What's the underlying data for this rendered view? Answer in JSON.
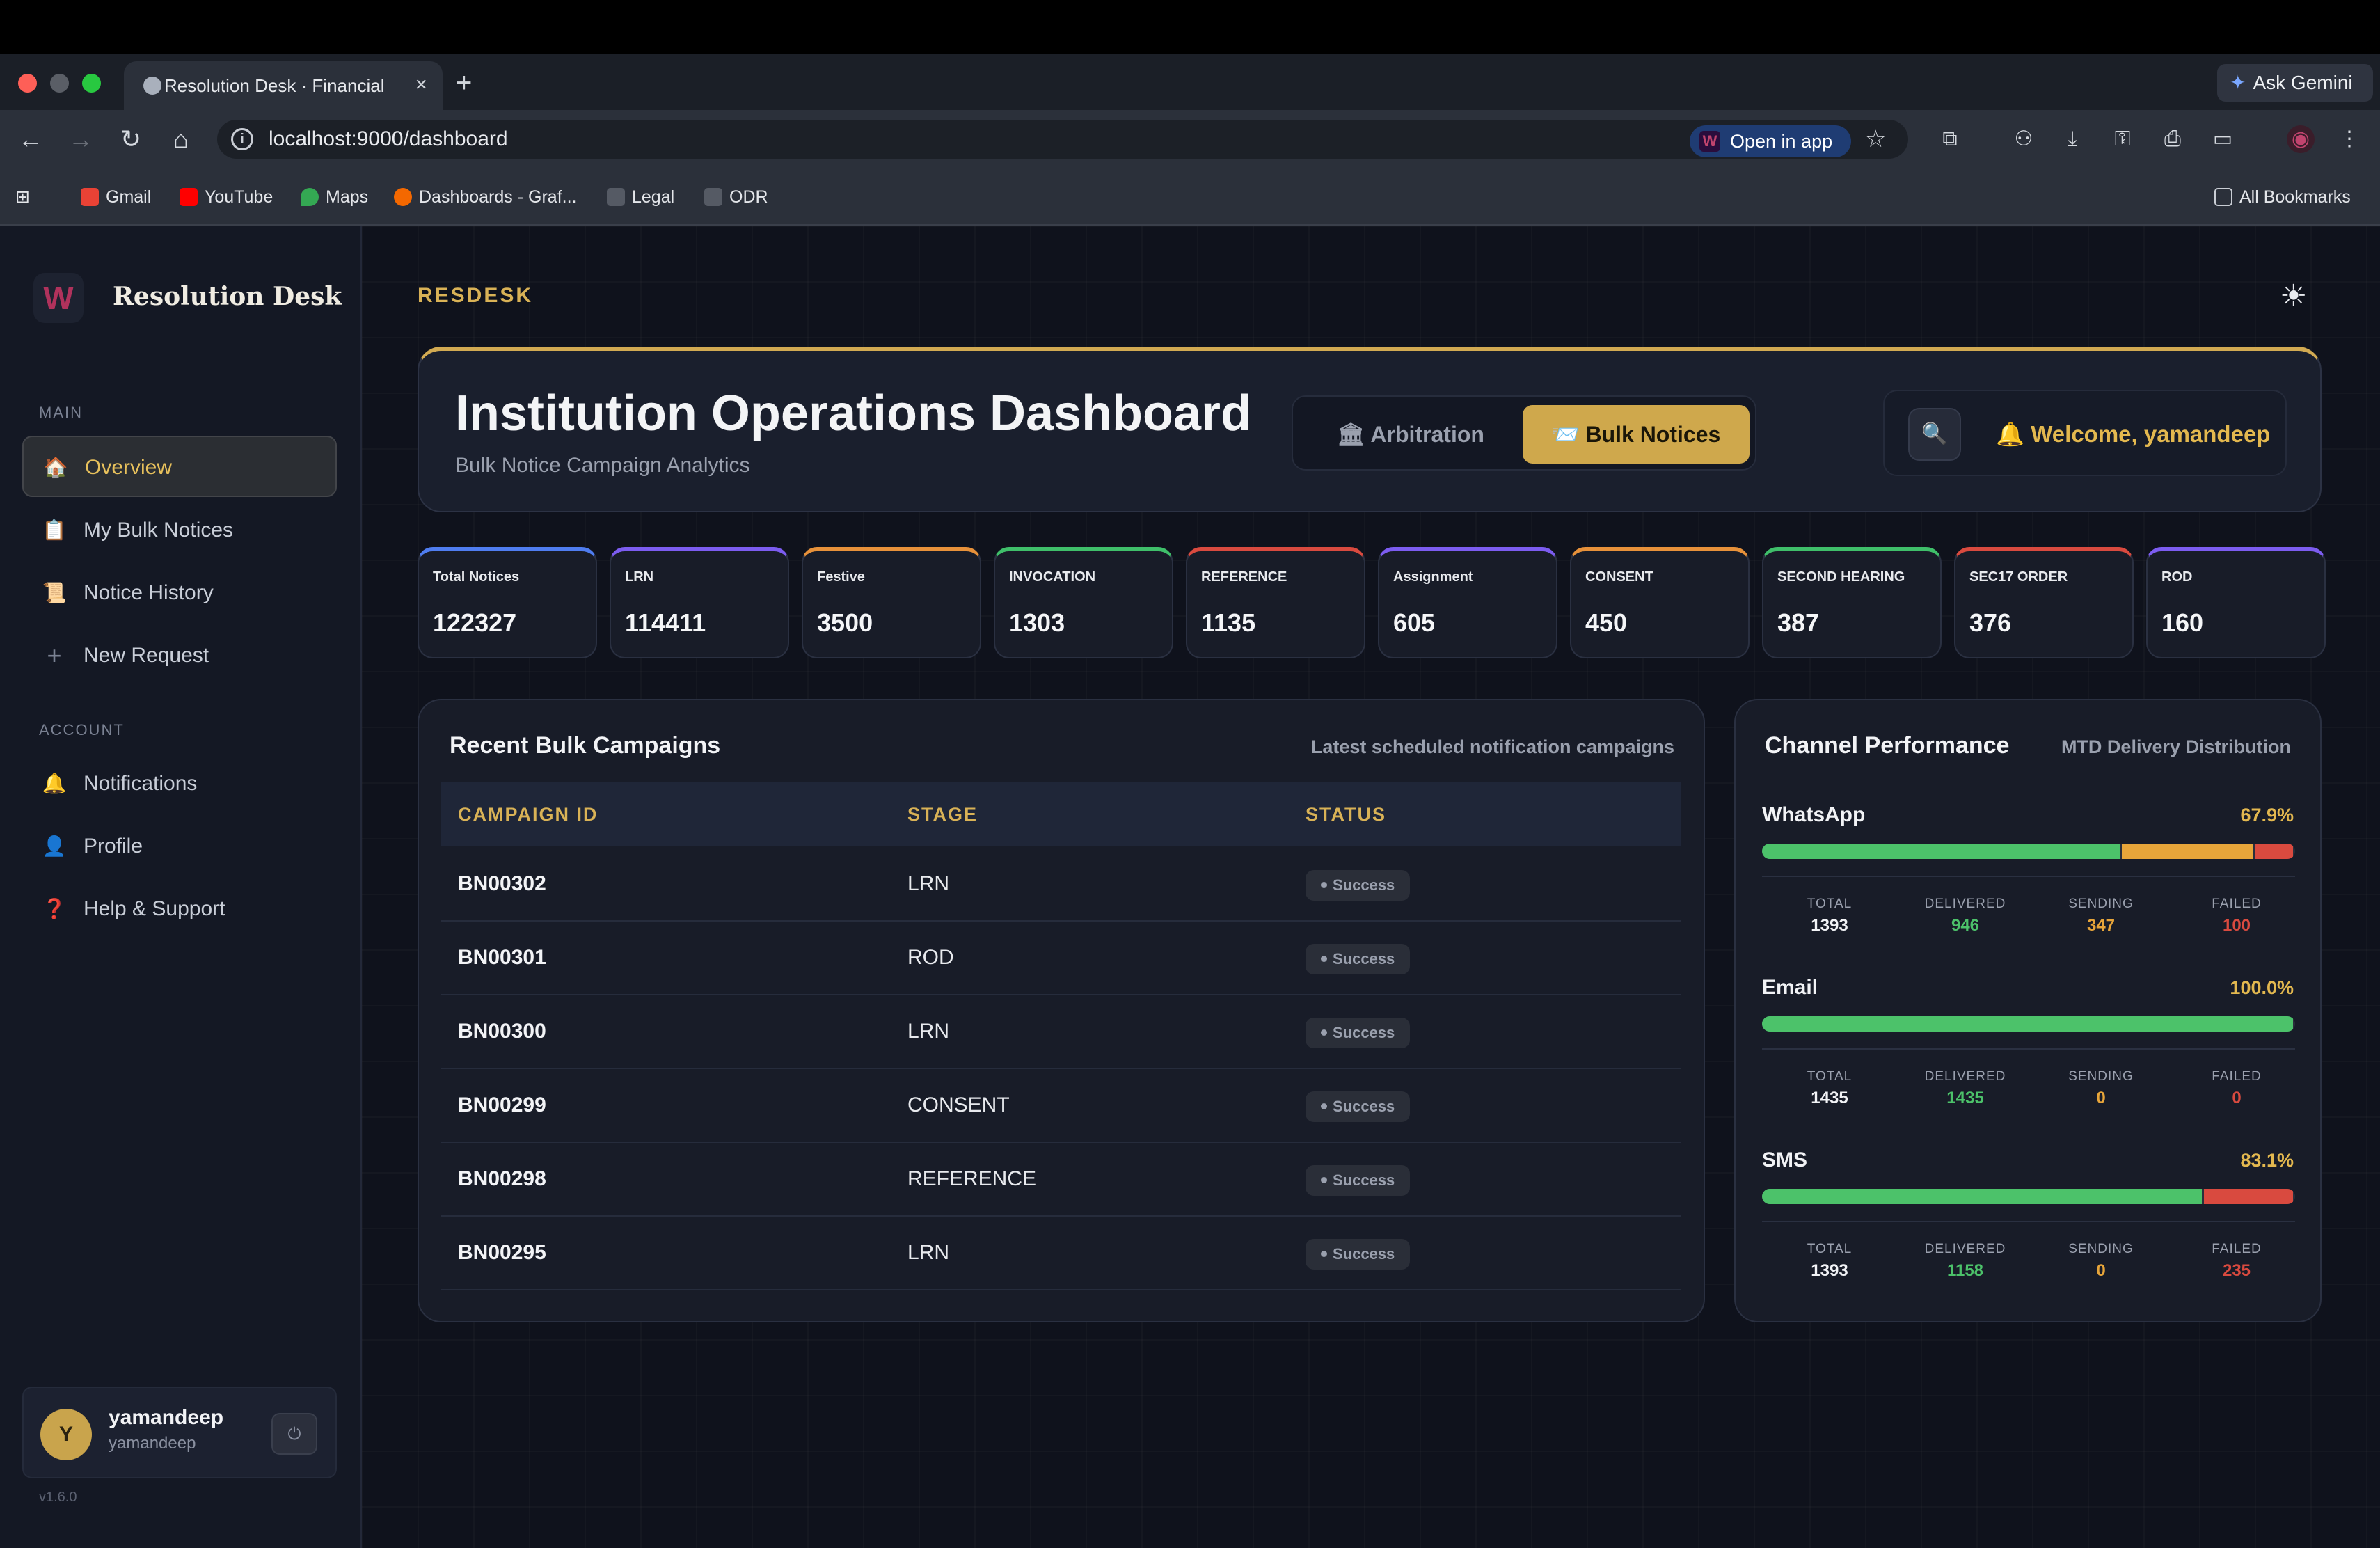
{
  "browser": {
    "tab_title": "Resolution Desk · Financial In",
    "url": "localhost:9000/dashboard",
    "open_in_app": "Open in app",
    "ask_gemini": "Ask Gemini",
    "bookmarks": [
      "Gmail",
      "YouTube",
      "Maps",
      "Dashboards - Graf...",
      "Legal",
      "ODR"
    ],
    "all_bookmarks": "All Bookmarks"
  },
  "sidebar": {
    "brand": "Resolution Desk",
    "logo_letter": "W",
    "main_label": "MAIN",
    "main_items": [
      {
        "label": "Overview",
        "icon": "🏠"
      },
      {
        "label": "My Bulk Notices",
        "icon": "📋"
      },
      {
        "label": "Notice History",
        "icon": "📜"
      },
      {
        "label": "New Request",
        "icon": "+"
      }
    ],
    "account_label": "ACCOUNT",
    "account_items": [
      {
        "label": "Notifications",
        "icon": "🔔"
      },
      {
        "label": "Profile",
        "icon": "👤"
      },
      {
        "label": "Help & Support",
        "icon": "❓"
      }
    ],
    "user": {
      "initial": "Y",
      "name": "yamandeep",
      "sub": "yamandeep"
    },
    "version": "v1.6.0"
  },
  "header": {
    "brand_tag": "RESDESK",
    "title": "Institution Operations Dashboard",
    "subtitle": "Bulk Notice Campaign Analytics",
    "mode_options": [
      "🏛 Arbitration",
      "📨 Bulk Notices"
    ],
    "active_mode": "Bulk Notices",
    "welcome": "🔔  Welcome, yamandeep"
  },
  "stats": [
    {
      "label": "Total Notices",
      "value": "122327",
      "color": "#4f7df0"
    },
    {
      "label": "LRN",
      "value": "114411",
      "color": "#7c5cf0"
    },
    {
      "label": "Festive",
      "value": "3500",
      "color": "#e7913a"
    },
    {
      "label": "INVOCATION",
      "value": "1303",
      "color": "#3fbf6a"
    },
    {
      "label": "REFERENCE",
      "value": "1135",
      "color": "#d94a3f"
    },
    {
      "label": "Assignment",
      "value": "605",
      "color": "#7c5cf0"
    },
    {
      "label": "CONSENT",
      "value": "450",
      "color": "#e7913a"
    },
    {
      "label": "SECOND HEARING",
      "value": "387",
      "color": "#3fbf6a"
    },
    {
      "label": "SEC17 ORDER",
      "value": "376",
      "color": "#d94a3f"
    },
    {
      "label": "ROD",
      "value": "160",
      "color": "#7c5cf0"
    }
  ],
  "campaigns": {
    "title": "Recent Bulk Campaigns",
    "subtitle": "Latest scheduled notification campaigns",
    "headers": [
      "CAMPAIGN ID",
      "STAGE",
      "STATUS"
    ],
    "rows": [
      {
        "id": "BN00302",
        "stage": "LRN",
        "status": "Success"
      },
      {
        "id": "BN00301",
        "stage": "ROD",
        "status": "Success"
      },
      {
        "id": "BN00300",
        "stage": "LRN",
        "status": "Success"
      },
      {
        "id": "BN00299",
        "stage": "CONSENT",
        "status": "Success"
      },
      {
        "id": "BN00298",
        "stage": "REFERENCE",
        "status": "Success"
      },
      {
        "id": "BN00295",
        "stage": "LRN",
        "status": "Success"
      }
    ]
  },
  "channels": {
    "title": "Channel Performance",
    "subtitle": "MTD Delivery Distribution",
    "metric_labels": [
      "TOTAL",
      "DELIVERED",
      "SENDING",
      "FAILED"
    ],
    "items": [
      {
        "name": "WhatsApp",
        "pct": "67.9%",
        "total": "1393",
        "delivered": "946",
        "sending": "347",
        "failed": "100"
      },
      {
        "name": "Email",
        "pct": "100.0%",
        "total": "1435",
        "delivered": "1435",
        "sending": "0",
        "failed": "0"
      },
      {
        "name": "SMS",
        "pct": "83.1%",
        "total": "1393",
        "delivered": "1158",
        "sending": "0",
        "failed": "235"
      }
    ]
  },
  "colors": {
    "accent_gold": "#d9b256",
    "delivered": "#4cc26a",
    "sending": "#e7a53a",
    "failed": "#d94a3f"
  }
}
